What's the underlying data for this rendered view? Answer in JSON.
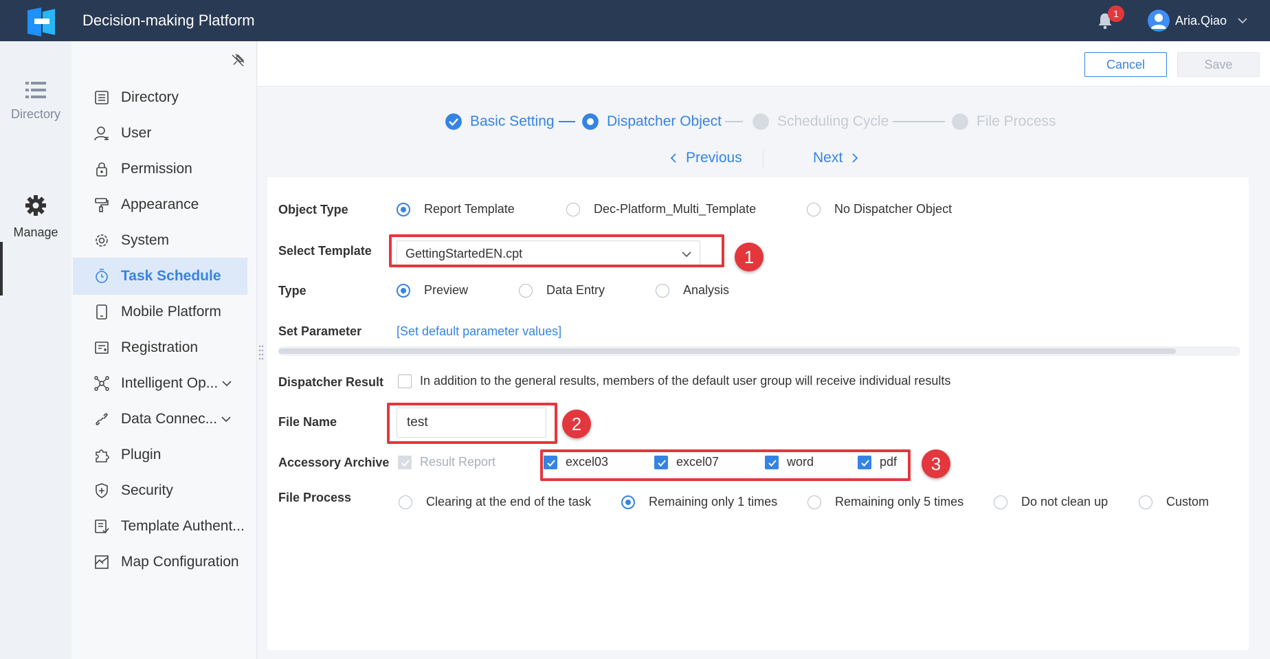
{
  "header": {
    "title": "Decision-making Platform",
    "notification_count": "1",
    "user_name": "Aria.Qiao"
  },
  "rail": {
    "items": [
      {
        "label": "Directory",
        "icon": "list-icon"
      },
      {
        "label": "Manage",
        "icon": "gear-icon",
        "active": true
      }
    ]
  },
  "sidebar": {
    "items": [
      {
        "label": "Directory",
        "icon": "directory-icon"
      },
      {
        "label": "User",
        "icon": "user-icon"
      },
      {
        "label": "Permission",
        "icon": "lock-icon"
      },
      {
        "label": "Appearance",
        "icon": "paint-roller-icon"
      },
      {
        "label": "System",
        "icon": "gear-icon"
      },
      {
        "label": "Task Schedule",
        "icon": "timer-icon",
        "active": true
      },
      {
        "label": "Mobile Platform",
        "icon": "tablet-icon"
      },
      {
        "label": "Registration",
        "icon": "registration-icon"
      },
      {
        "label": "Intelligent Op...",
        "icon": "network-icon",
        "expandable": true
      },
      {
        "label": "Data Connec...",
        "icon": "link-icon",
        "expandable": true
      },
      {
        "label": "Plugin",
        "icon": "puzzle-icon"
      },
      {
        "label": "Security",
        "icon": "shield-icon"
      },
      {
        "label": "Template Authent...",
        "icon": "document-check-icon"
      },
      {
        "label": "Map Configuration",
        "icon": "map-icon"
      }
    ]
  },
  "actions": {
    "cancel_label": "Cancel",
    "save_label": "Save"
  },
  "steps": {
    "items": [
      {
        "label": "Basic Setting",
        "state": "done"
      },
      {
        "label": "Dispatcher Object",
        "state": "current"
      },
      {
        "label": "Scheduling Cycle",
        "state": "pending"
      },
      {
        "label": "File Process",
        "state": "pending"
      }
    ],
    "previous_label": "Previous",
    "next_label": "Next"
  },
  "form": {
    "object_type": {
      "label": "Object Type",
      "options": [
        "Report Template",
        "Dec-Platform_Multi_Template",
        "No Dispatcher Object"
      ],
      "selected": "Report Template"
    },
    "select_template": {
      "label": "Select Template",
      "value": "GettingStartedEN.cpt"
    },
    "type": {
      "label": "Type",
      "options": [
        "Preview",
        "Data Entry",
        "Analysis"
      ],
      "selected": "Preview"
    },
    "set_parameter": {
      "label": "Set Parameter",
      "link": "[Set default parameter values]"
    },
    "dispatcher_result": {
      "label": "Dispatcher Result",
      "checkbox_label": "In addition to the general results, members of the default user group will receive individual results",
      "checked": false
    },
    "file_name": {
      "label": "File Name",
      "value": "test"
    },
    "accessory_archive": {
      "label": "Accessory Archive",
      "result_report": "Result Report",
      "formats": [
        {
          "label": "excel03",
          "checked": true
        },
        {
          "label": "excel07",
          "checked": true
        },
        {
          "label": "word",
          "checked": true
        },
        {
          "label": "pdf",
          "checked": true
        }
      ]
    },
    "file_process": {
      "label": "File Process",
      "options": [
        "Clearing at the end of the task",
        "Remaining only 1 times",
        "Remaining only 5 times",
        "Do not clean up",
        "Custom"
      ],
      "selected": "Remaining only 1 times"
    }
  },
  "annotations": [
    "1",
    "2",
    "3"
  ],
  "colors": {
    "header_bg": "#293a54",
    "accent": "#3584e4",
    "annotation": "#e3373d"
  }
}
